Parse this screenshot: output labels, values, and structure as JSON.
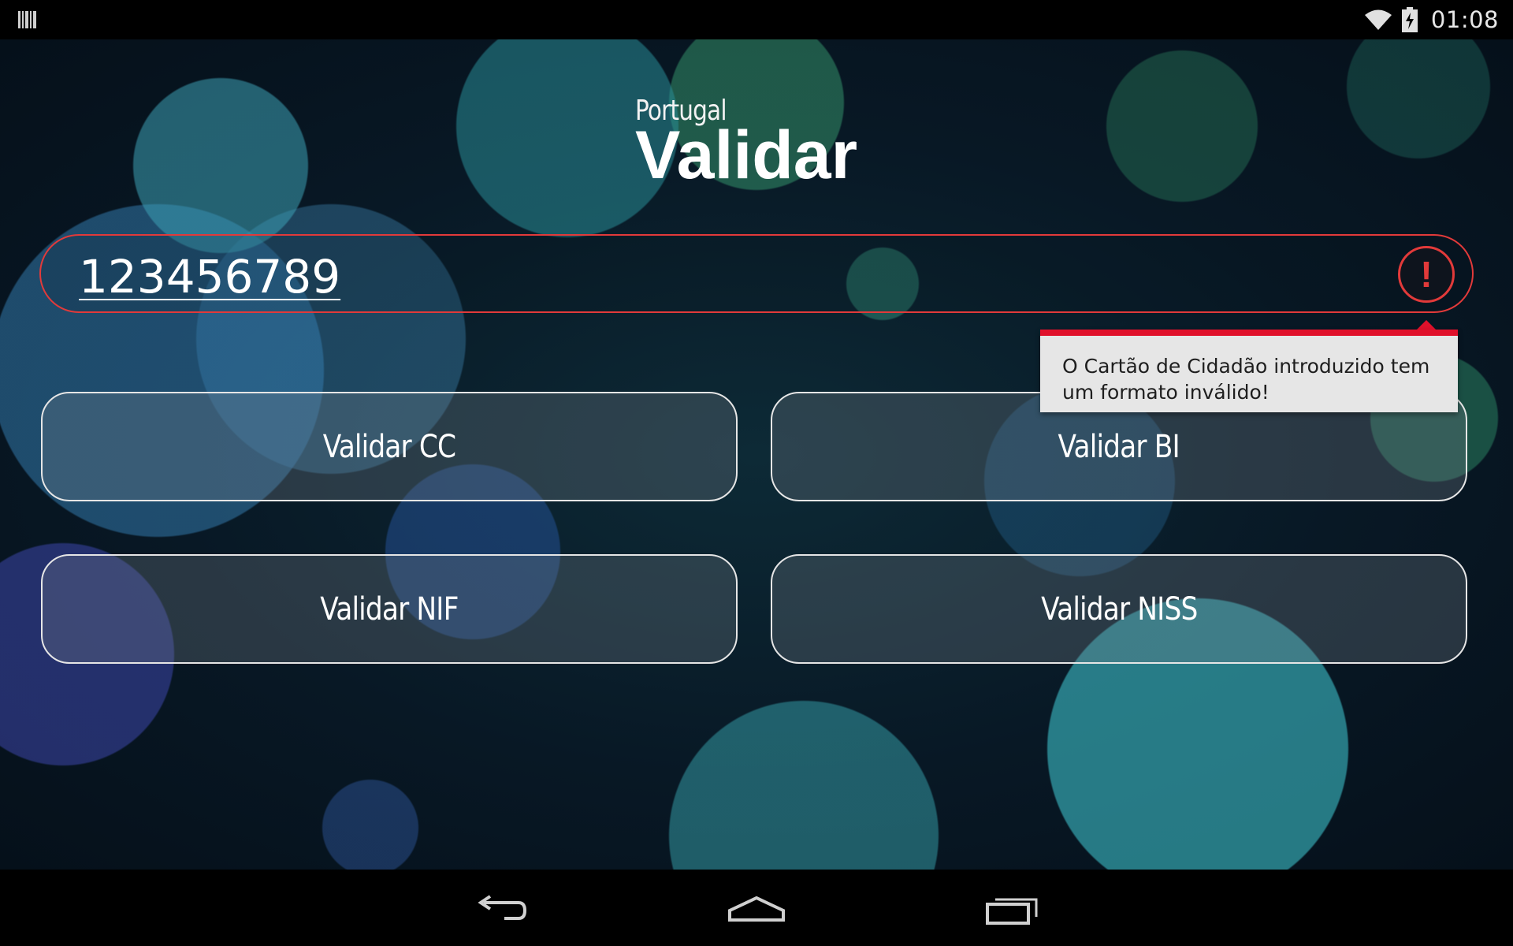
{
  "status_bar": {
    "time": "01:08",
    "icons": [
      "barcode-icon",
      "wifi-icon",
      "battery-charging-icon"
    ]
  },
  "app": {
    "subtitle": "Portugal",
    "title": "Validar"
  },
  "input": {
    "value": "123456789",
    "error_icon": "error-icon",
    "error_symbol": "!"
  },
  "tooltip": {
    "message": "O Cartão de Cidadão introduzido tem um formato inválido!"
  },
  "buttons": {
    "cc": "Validar CC",
    "bi": "Validar BI",
    "nif": "Validar NIF",
    "niss": "Validar NISS"
  },
  "nav_bar": {
    "icons": [
      "back-icon",
      "home-icon",
      "recents-icon"
    ]
  },
  "colors": {
    "error": "#e23a3a",
    "tooltip_accent": "#e0112b",
    "tooltip_bg": "#e6e6e6"
  }
}
